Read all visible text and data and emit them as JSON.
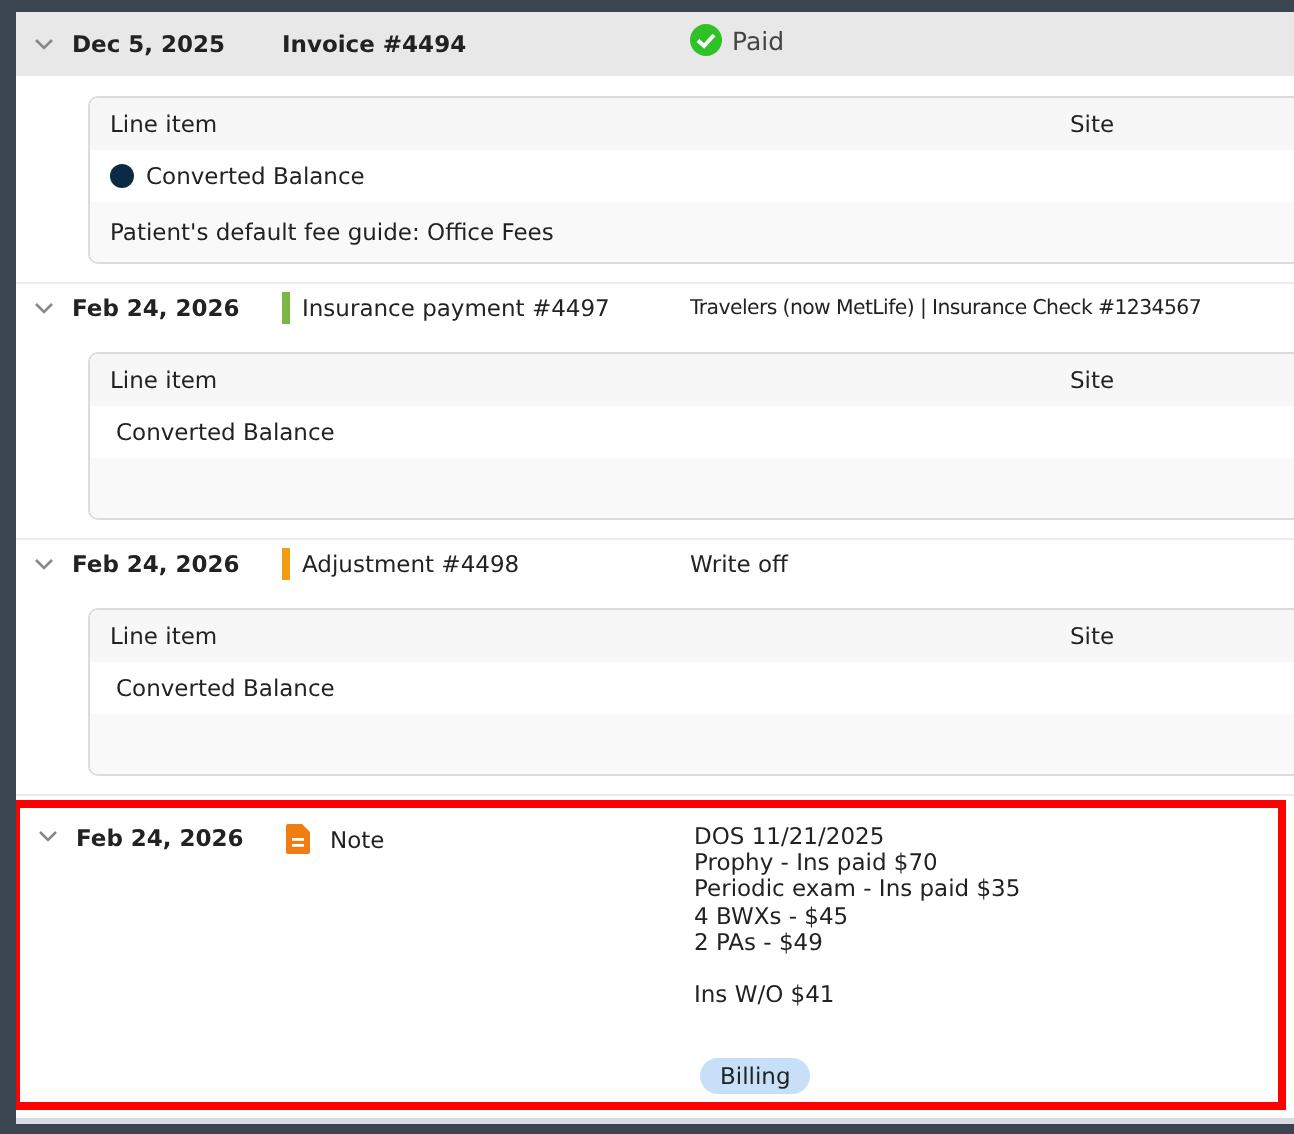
{
  "entries": [
    {
      "kind": "invoice",
      "expanded": true,
      "highlighted": false,
      "date": "Dec 5, 2025",
      "title": "Invoice #4494",
      "status": "Paid",
      "card": {
        "columns": [
          "Line item",
          "Site"
        ],
        "rows": [
          {
            "label": "Converted Balance",
            "color": "#0d2a45"
          }
        ],
        "footer": "Patient's default fee guide: Office Fees"
      }
    },
    {
      "kind": "payment",
      "expanded": true,
      "highlighted": false,
      "date": "Feb 24, 2026",
      "color": "#7ab648",
      "title": "Insurance payment #4497",
      "description": "Travelers (now MetLife) | Insurance Check #1234567",
      "card": {
        "columns": [
          "Line item",
          "Site"
        ],
        "rows": [
          {
            "label": "Converted Balance"
          }
        ]
      }
    },
    {
      "kind": "adjustment",
      "expanded": true,
      "highlighted": false,
      "date": "Feb 24, 2026",
      "color": "#f39c12",
      "title": "Adjustment #4498",
      "description": "Write off",
      "card": {
        "columns": [
          "Line item",
          "Site"
        ],
        "rows": [
          {
            "label": "Converted Balance"
          }
        ]
      }
    },
    {
      "kind": "note",
      "expanded": true,
      "highlighted": true,
      "date": "Feb 24, 2026",
      "title": "Note",
      "paragraphs": [
        [
          "DOS 11/21/2025",
          "Prophy - Ins paid $70",
          "Periodic exam - Ins paid $35",
          "4 BWXs - $45",
          "2 PAs - $49"
        ],
        [
          "Ins W/O $41"
        ]
      ],
      "tag": "Billing"
    }
  ]
}
